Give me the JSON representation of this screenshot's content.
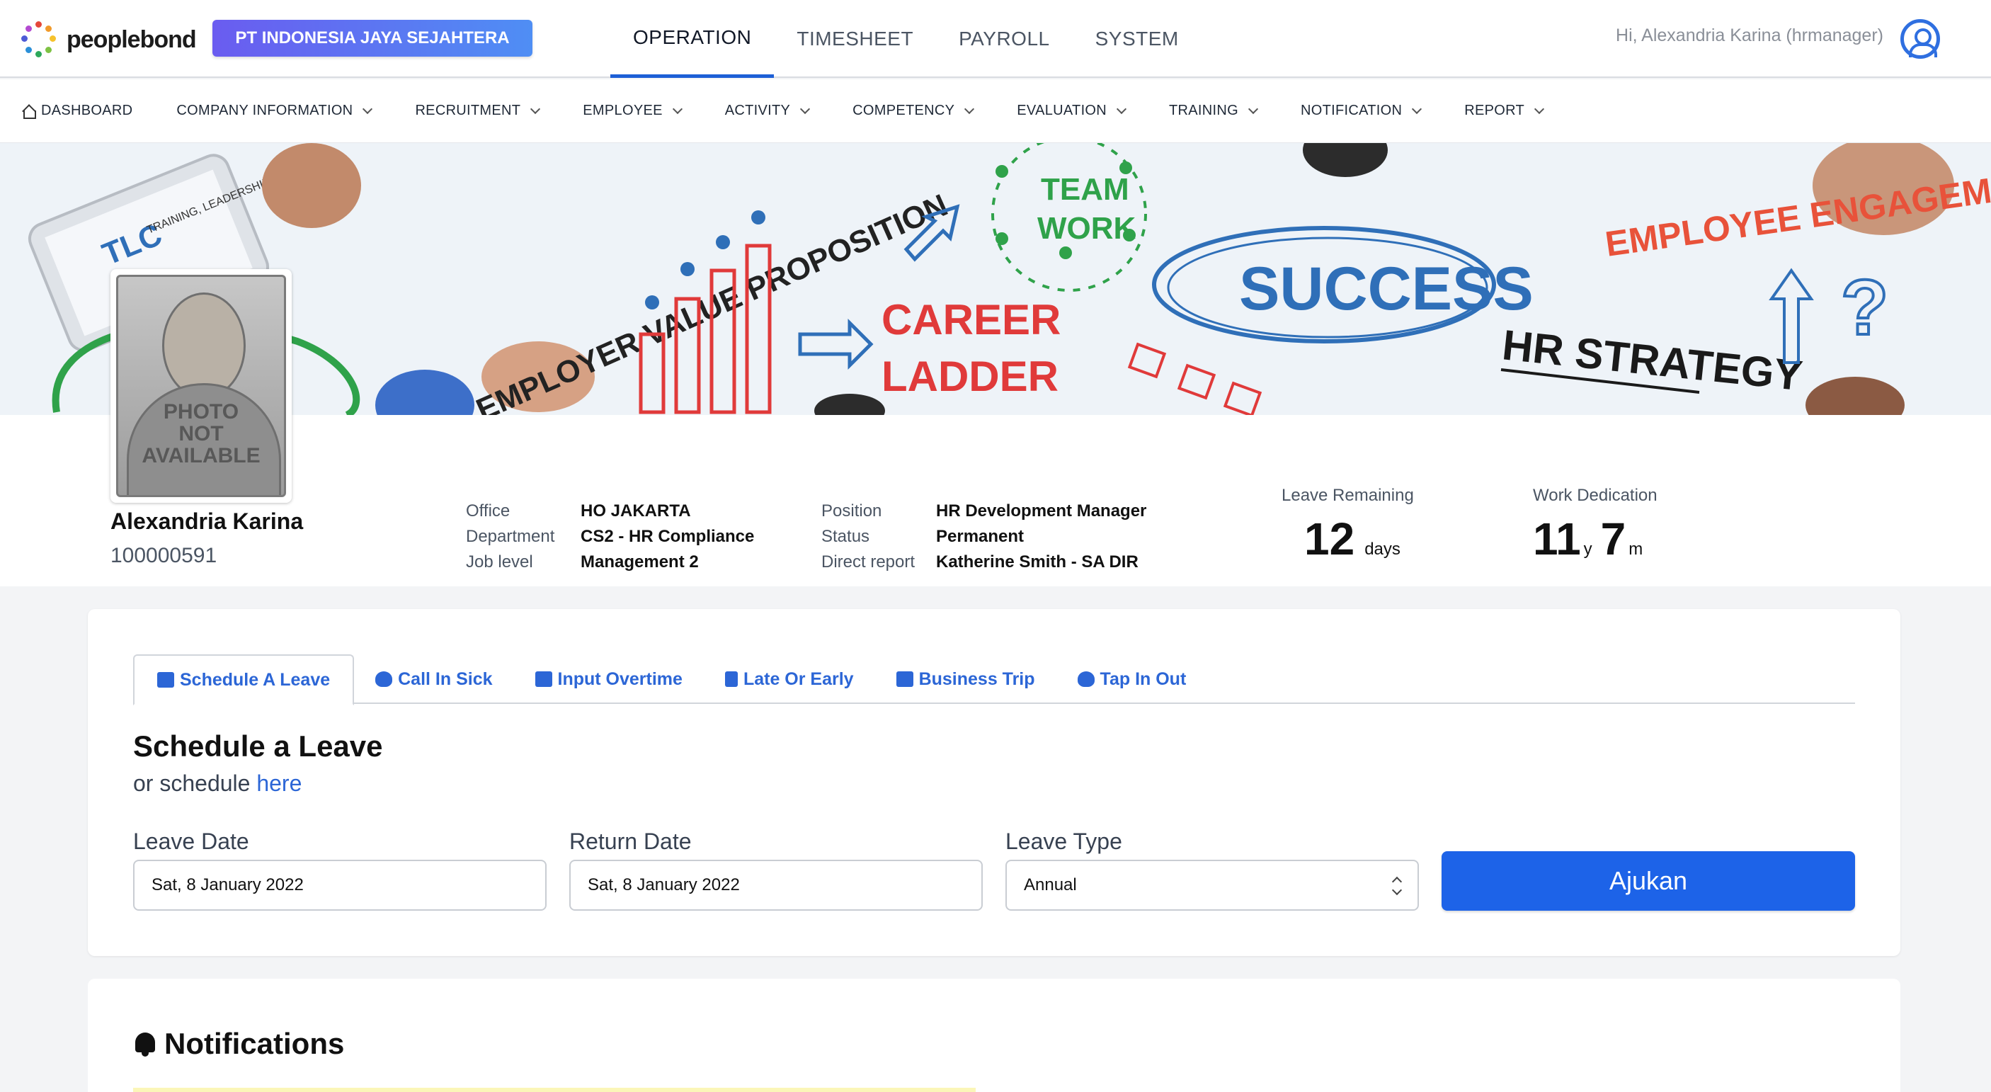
{
  "app": {
    "logo_text": "peoplebond",
    "company": "PT INDONESIA JAYA SEJAHTERA",
    "greeting": "Hi, Alexandria Karina (hrmanager)"
  },
  "main_tabs": [
    {
      "label": "OPERATION",
      "active": true
    },
    {
      "label": "TIMESHEET",
      "active": false
    },
    {
      "label": "PAYROLL",
      "active": false
    },
    {
      "label": "SYSTEM",
      "active": false
    }
  ],
  "subnav": [
    {
      "label": "DASHBOARD",
      "icon": "home-icon",
      "dropdown": false
    },
    {
      "label": "COMPANY INFORMATION",
      "dropdown": true
    },
    {
      "label": "RECRUITMENT",
      "dropdown": true
    },
    {
      "label": "EMPLOYEE",
      "dropdown": true
    },
    {
      "label": "ACTIVITY",
      "dropdown": true
    },
    {
      "label": "COMPETENCY",
      "dropdown": true
    },
    {
      "label": "EVALUATION",
      "dropdown": true
    },
    {
      "label": "TRAINING",
      "dropdown": true
    },
    {
      "label": "NOTIFICATION",
      "dropdown": true
    },
    {
      "label": "REPORT",
      "dropdown": true
    }
  ],
  "banner": {
    "texts": [
      "TRAINING, LEADERSHIP CONSULTING",
      "EMPLOYER VALUE PROPOSITION",
      "TEAM",
      "WORK",
      "CAREER",
      "LADDER",
      "SUCCESS",
      "EMPLOYEE ENGAGEMENT",
      "HR STRATEGY"
    ]
  },
  "profile": {
    "photo_text": [
      "PHOTO",
      "NOT",
      "AVAILABLE"
    ],
    "name": "Alexandria Karina",
    "id": "100000591",
    "office_label": "Office",
    "office": "HO JAKARTA",
    "department_label": "Department",
    "department": "CS2 - HR Compliance",
    "job_level_label": "Job level",
    "job_level": "Management 2",
    "position_label": "Position",
    "position": "HR Development Manager",
    "status_label": "Status",
    "status": "Permanent",
    "direct_report_label": "Direct report",
    "direct_report": "Katherine Smith - SA DIR",
    "leave_label": "Leave Remaining",
    "leave_value": "12",
    "leave_unit": "days",
    "dedication_label": "Work Dedication",
    "dedication_years": "11",
    "dedication_years_unit": "y",
    "dedication_months": "7",
    "dedication_months_unit": "m"
  },
  "leave_form": {
    "tabs": [
      {
        "label": "Schedule A Leave",
        "icon": "briefcase-icon",
        "active": true
      },
      {
        "label": "Call In Sick",
        "icon": "head-side-cough-icon",
        "active": false
      },
      {
        "label": "Input Overtime",
        "icon": "business-time-icon",
        "active": false
      },
      {
        "label": "Late Or Early",
        "icon": "suitcase-icon",
        "active": false
      },
      {
        "label": "Business Trip",
        "icon": "suitcase-rolling-icon",
        "active": false
      },
      {
        "label": "Tap In Out",
        "icon": "user-clock-icon",
        "active": false
      }
    ],
    "title": "Schedule a Leave",
    "sub_prefix": "or schedule",
    "sub_link": "here",
    "leave_date_label": "Leave Date",
    "leave_date": "Sat, 8 January 2022",
    "return_date_label": "Return Date",
    "return_date": "Sat, 8 January 2022",
    "leave_type_label": "Leave Type",
    "leave_type": "Annual",
    "submit": "Ajukan"
  },
  "notifications": {
    "title": "Notifications"
  },
  "colors": {
    "accent": "#1d63e8",
    "tab_text": "#2c66d6",
    "badge_start": "#6a5cf0",
    "badge_end": "#4f8ef4"
  }
}
